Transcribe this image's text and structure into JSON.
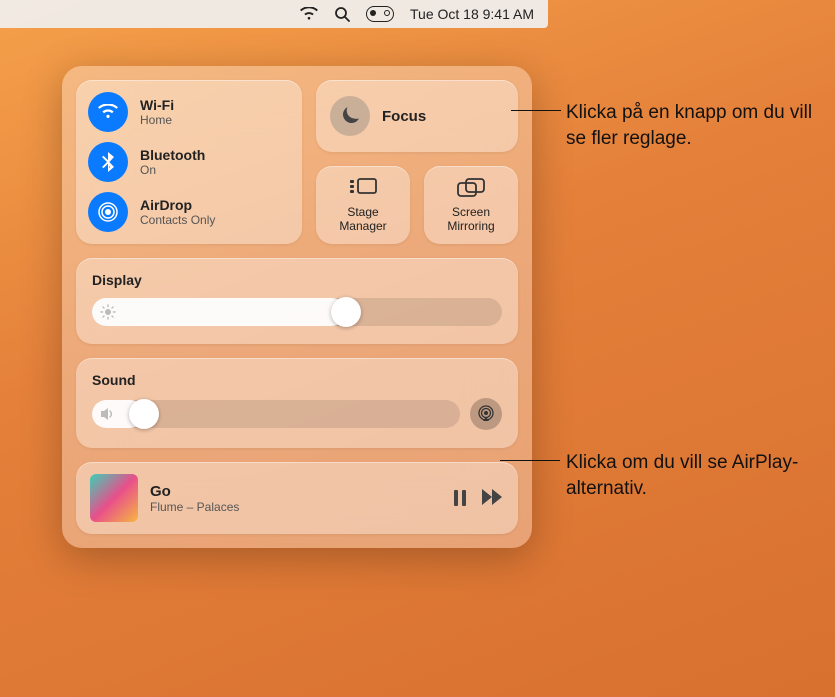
{
  "menubar": {
    "datetime": "Tue Oct 18  9:41 AM"
  },
  "connectivity": {
    "wifi": {
      "label": "Wi-Fi",
      "sub": "Home"
    },
    "bluetooth": {
      "label": "Bluetooth",
      "sub": "On"
    },
    "airdrop": {
      "label": "AirDrop",
      "sub": "Contacts Only"
    }
  },
  "focus": {
    "label": "Focus"
  },
  "stage": {
    "label": "Stage Manager"
  },
  "mirror": {
    "label": "Screen Mirroring"
  },
  "display": {
    "title": "Display",
    "value_pct": 62
  },
  "sound": {
    "title": "Sound",
    "value_pct": 14
  },
  "now_playing": {
    "title": "Go",
    "subtitle": "Flume – Palaces"
  },
  "callouts": {
    "focus": "Klicka på en knapp om du vill se fler reglage.",
    "airplay": "Klicka om du vill se AirPlay-alternativ."
  }
}
